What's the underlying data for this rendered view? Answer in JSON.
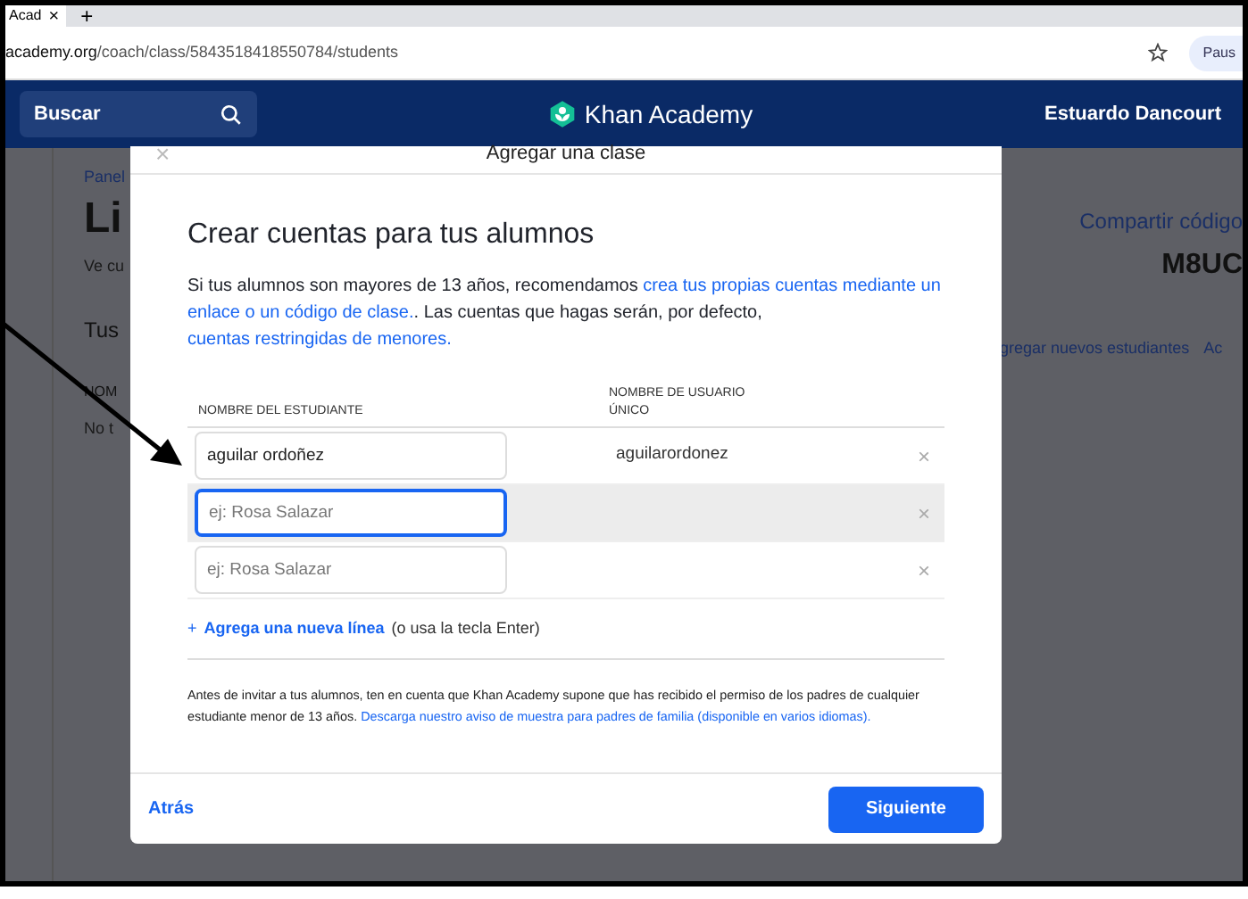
{
  "browser": {
    "tab_title": "Acad",
    "tab_close": "×",
    "new_tab": "+",
    "url_domain": "academy.org",
    "url_path": "/coach/class/5843518418550784/students",
    "profile_chip": "Paus"
  },
  "navbar": {
    "search_label": "Buscar",
    "logo_text": "Khan Academy",
    "user_name": "Estuardo Dancourt"
  },
  "background_page": {
    "left_texts": [
      {
        "kind": "crumb",
        "text": "Panel"
      },
      {
        "kind": "title",
        "text": "Li"
      },
      {
        "kind": "small",
        "text": "Ve cu"
      },
      {
        "kind": "section",
        "text": "Tus"
      },
      {
        "kind": "caps",
        "text": "NOM"
      },
      {
        "kind": "small",
        "text": "No t"
      }
    ],
    "right_texts": [
      {
        "kind": "link",
        "text": "Compartir código"
      },
      {
        "kind": "code",
        "text": "M8UC"
      },
      {
        "kind": "tab",
        "text": "gregar nuevos estudiantes"
      },
      {
        "kind": "tab",
        "text": "Ac"
      }
    ]
  },
  "modal": {
    "title": "Agregar una clase",
    "close": "×",
    "heading": "Crear cuentas para tus alumnos",
    "intro": [
      {
        "text": "Si tus alumnos son mayores de 13 años, recomendamos ",
        "link": false
      },
      {
        "text": "crea tus propias cuentas mediante un",
        "link": true
      },
      {
        "text": "enlace o un código de clase.",
        "link": true
      },
      {
        "text": ". Las cuentas que hagas serán, por defecto, ",
        "link": false
      },
      {
        "text": "cuentas restringidas de",
        "link": true
      },
      {
        "text": "menores.",
        "link": true
      }
    ],
    "columns": [
      "NOMBRE DEL ESTUDIANTE",
      "NOMBRE DE USUARIO ÚNICO"
    ],
    "rows": [
      {
        "name": "aguilar ordoñez",
        "username": "aguilarordonez",
        "focused": false,
        "remove": "×"
      },
      {
        "placeholder": "ej: Rosa Salazar",
        "focused": true,
        "remove": "×"
      },
      {
        "placeholder": "ej: Rosa Salazar",
        "focused": false,
        "remove": "×"
      }
    ],
    "add_line": {
      "plus": "+",
      "link": "Agrega una nueva línea",
      "hint": "(o usa la tecla Enter)"
    },
    "notice": [
      {
        "text": "Antes de invitar a tus alumnos, ten en cuenta que Khan Academy supone que has recibido el permiso de los padres de cualquier estudiante menor de 13 años. ",
        "link": false
      },
      {
        "text": "Descarga nuestro aviso de muestra para padres de familia (disponible en varios",
        "link": true
      },
      {
        "text": "idiomas).",
        "link": true
      }
    ],
    "back": "Atrás",
    "next": "Siguiente"
  }
}
